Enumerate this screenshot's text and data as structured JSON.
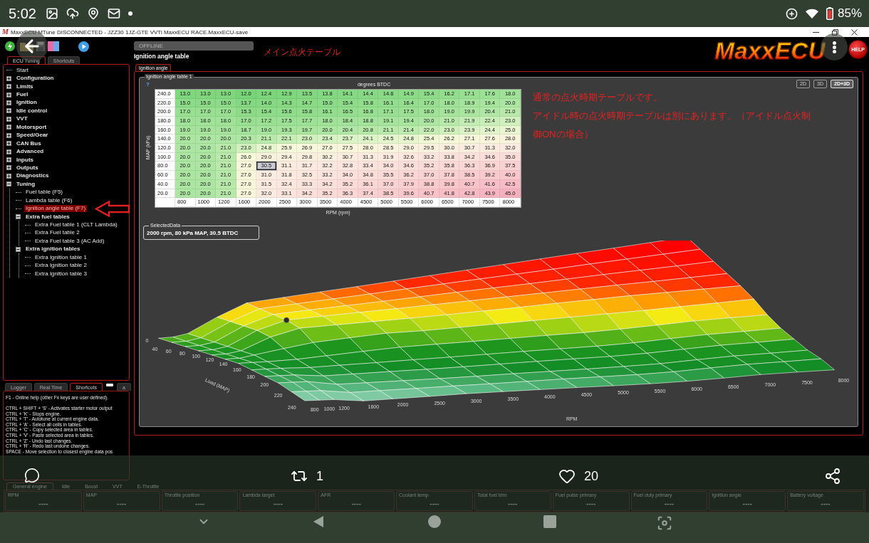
{
  "status_bar": {
    "time": "5:02",
    "battery": "85%"
  },
  "window": {
    "icon_letter": "M",
    "title": "MaxxECU MTune DISCONNECTED - JZZ30 1JZ-GTE VVTi MaxxECU RACE.MaxxECU-save"
  },
  "left_tabs": [
    {
      "label": "ECU Tuning",
      "selected": true
    },
    {
      "label": "Shortcuts",
      "selected": false
    }
  ],
  "tree": [
    {
      "label": "Start",
      "kind": "item",
      "selected": false
    },
    {
      "label": "Configuration",
      "kind": "group",
      "expanded": false,
      "selected": false
    },
    {
      "label": "Limits",
      "kind": "group",
      "expanded": false,
      "selected": false
    },
    {
      "label": "Fuel",
      "kind": "group",
      "expanded": false,
      "selected": false
    },
    {
      "label": "Ignition",
      "kind": "group",
      "expanded": false,
      "selected": false
    },
    {
      "label": "Idle control",
      "kind": "group",
      "expanded": false,
      "selected": false
    },
    {
      "label": "VVT",
      "kind": "group",
      "expanded": false,
      "selected": false
    },
    {
      "label": "Motorsport",
      "kind": "group",
      "expanded": false,
      "selected": false
    },
    {
      "label": "Speed/Gear",
      "kind": "group",
      "expanded": false,
      "selected": false
    },
    {
      "label": "CAN Bus",
      "kind": "group",
      "expanded": false,
      "selected": false
    },
    {
      "label": "Advanced",
      "kind": "group",
      "expanded": false,
      "selected": false
    },
    {
      "label": "Inputs",
      "kind": "group",
      "expanded": false,
      "selected": false
    },
    {
      "label": "Outputs",
      "kind": "group",
      "expanded": false,
      "selected": false
    },
    {
      "label": "Diagnostics",
      "kind": "group",
      "expanded": false,
      "selected": false
    },
    {
      "label": "Tuning",
      "kind": "group",
      "expanded": true,
      "selected": false,
      "children": [
        {
          "label": "Fuel table (F5)",
          "kind": "item",
          "selected": false
        },
        {
          "label": "Lambda table (F6)",
          "kind": "item",
          "selected": false
        },
        {
          "label": "Ignition angle table (F7)",
          "kind": "item",
          "selected": true
        },
        {
          "label": "Extra fuel tables",
          "kind": "group",
          "expanded": true,
          "selected": false,
          "children": [
            {
              "label": "Extra Fuel table 1 (CLT Lambda)",
              "kind": "item",
              "selected": false
            },
            {
              "label": "Extra Fuel table 2",
              "kind": "item",
              "selected": false
            },
            {
              "label": "Extra Fuel table 3 (AC Add)",
              "kind": "item",
              "selected": false
            }
          ]
        },
        {
          "label": "Extra ignition tables",
          "kind": "group",
          "expanded": true,
          "selected": false,
          "children": [
            {
              "label": "Extra Ignition table 1",
              "kind": "item",
              "selected": false
            },
            {
              "label": "Extra Ignition table 2",
              "kind": "item",
              "selected": false
            },
            {
              "label": "Extra Ignition table 3",
              "kind": "item",
              "selected": false
            }
          ]
        }
      ]
    }
  ],
  "help_tabs": [
    {
      "label": "Logger",
      "selected": false
    },
    {
      "label": "Real Time",
      "selected": false
    },
    {
      "label": "Shortcuts",
      "selected": true
    },
    {
      "label": "a",
      "selected": false
    }
  ],
  "help_text": {
    "intro": "F1 - Online help (other Fx keys are user defined).",
    "shortcuts": [
      "CTRL + SHIFT + 'S' - Activates starter motor output",
      "CTRL + 'K' - Stops engine.",
      "CTRL + 'T' - Autotune at current engine data.",
      "CTRL + 'A' - Select all cells in tables.",
      "CTRL + 'C' - Copy selected area in tables.",
      "CTRL + 'V' - Paste selected area in tables.",
      "CTRL + 'Z' - Undo last changes.",
      "CTRL + 'R' - Redo last undone changes.",
      "SPACE - Move selection to closest engine data pos"
    ]
  },
  "header": {
    "status": "OFFLINE",
    "title": "Ignition angle table",
    "annotation": "メイン点火テーブル",
    "logo": "MaxxECU",
    "help_button": "HELP"
  },
  "content_tabs": [
    {
      "label": "Ignition angle",
      "selected": true
    }
  ],
  "table": {
    "title": "Ignition angle table 1",
    "help_mark": "?",
    "unit_label": "degrees BTDC",
    "view_buttons": [
      {
        "label": "2D",
        "selected": false
      },
      {
        "label": "3D",
        "selected": false
      },
      {
        "label": "2D+3D",
        "selected": true
      }
    ],
    "y_label": "MAP (kPa)",
    "rows": [
      {
        "map": "240.0",
        "cells": [
          {
            "value": "13.0",
            "selected": false
          },
          {
            "value": "13.0",
            "selected": false
          },
          {
            "value": "13.0",
            "selected": false
          },
          {
            "value": "12.0",
            "selected": false
          },
          {
            "value": "12.4",
            "selected": false
          },
          {
            "value": "12.9",
            "selected": false
          },
          {
            "value": "13.5",
            "selected": false
          },
          {
            "value": "13.8",
            "selected": false
          },
          {
            "value": "14.1",
            "selected": false
          },
          {
            "value": "14.4",
            "selected": false
          },
          {
            "value": "14.6",
            "selected": false
          },
          {
            "value": "14.9",
            "selected": false
          },
          {
            "value": "15.4",
            "selected": false
          },
          {
            "value": "16.2",
            "selected": false
          },
          {
            "value": "17.1",
            "selected": false
          },
          {
            "value": "17.6",
            "selected": false
          },
          {
            "value": "18.0",
            "selected": false
          }
        ]
      },
      {
        "map": "220.0",
        "cells": [
          {
            "value": "15.0",
            "selected": false
          },
          {
            "value": "15.0",
            "selected": false
          },
          {
            "value": "15.0",
            "selected": false
          },
          {
            "value": "13.7",
            "selected": false
          },
          {
            "value": "14.0",
            "selected": false
          },
          {
            "value": "14.3",
            "selected": false
          },
          {
            "value": "14.7",
            "selected": false
          },
          {
            "value": "15.0",
            "selected": false
          },
          {
            "value": "15.4",
            "selected": false
          },
          {
            "value": "15.8",
            "selected": false
          },
          {
            "value": "16.1",
            "selected": false
          },
          {
            "value": "16.4",
            "selected": false
          },
          {
            "value": "17.0",
            "selected": false
          },
          {
            "value": "18.0",
            "selected": false
          },
          {
            "value": "18.9",
            "selected": false
          },
          {
            "value": "19.4",
            "selected": false
          },
          {
            "value": "20.0",
            "selected": false
          }
        ]
      },
      {
        "map": "200.0",
        "cells": [
          {
            "value": "17.0",
            "selected": false
          },
          {
            "value": "17.0",
            "selected": false
          },
          {
            "value": "17.0",
            "selected": false
          },
          {
            "value": "15.3",
            "selected": false
          },
          {
            "value": "15.4",
            "selected": false
          },
          {
            "value": "15.6",
            "selected": false
          },
          {
            "value": "15.8",
            "selected": false
          },
          {
            "value": "16.1",
            "selected": false
          },
          {
            "value": "16.5",
            "selected": false
          },
          {
            "value": "16.8",
            "selected": false
          },
          {
            "value": "17.1",
            "selected": false
          },
          {
            "value": "17.5",
            "selected": false
          },
          {
            "value": "18.0",
            "selected": false
          },
          {
            "value": "19.0",
            "selected": false
          },
          {
            "value": "19.9",
            "selected": false
          },
          {
            "value": "20.4",
            "selected": false
          },
          {
            "value": "21.0",
            "selected": false
          }
        ]
      },
      {
        "map": "180.0",
        "cells": [
          {
            "value": "18.0",
            "selected": false
          },
          {
            "value": "18.0",
            "selected": false
          },
          {
            "value": "18.0",
            "selected": false
          },
          {
            "value": "17.0",
            "selected": false
          },
          {
            "value": "17.2",
            "selected": false
          },
          {
            "value": "17.5",
            "selected": false
          },
          {
            "value": "17.7",
            "selected": false
          },
          {
            "value": "18.0",
            "selected": false
          },
          {
            "value": "18.4",
            "selected": false
          },
          {
            "value": "18.8",
            "selected": false
          },
          {
            "value": "19.1",
            "selected": false
          },
          {
            "value": "19.4",
            "selected": false
          },
          {
            "value": "20.0",
            "selected": false
          },
          {
            "value": "21.0",
            "selected": false
          },
          {
            "value": "21.9",
            "selected": false
          },
          {
            "value": "22.4",
            "selected": false
          },
          {
            "value": "23.0",
            "selected": false
          }
        ]
      },
      {
        "map": "160.0",
        "cells": [
          {
            "value": "19.0",
            "selected": false
          },
          {
            "value": "19.0",
            "selected": false
          },
          {
            "value": "19.0",
            "selected": false
          },
          {
            "value": "18.7",
            "selected": false
          },
          {
            "value": "19.0",
            "selected": false
          },
          {
            "value": "19.3",
            "selected": false
          },
          {
            "value": "19.7",
            "selected": false
          },
          {
            "value": "20.0",
            "selected": false
          },
          {
            "value": "20.4",
            "selected": false
          },
          {
            "value": "20.8",
            "selected": false
          },
          {
            "value": "21.1",
            "selected": false
          },
          {
            "value": "21.4",
            "selected": false
          },
          {
            "value": "22.0",
            "selected": false
          },
          {
            "value": "23.0",
            "selected": false
          },
          {
            "value": "23.9",
            "selected": false
          },
          {
            "value": "24.4",
            "selected": false
          },
          {
            "value": "25.0",
            "selected": false
          }
        ]
      },
      {
        "map": "140.0",
        "cells": [
          {
            "value": "20.0",
            "selected": false
          },
          {
            "value": "20.0",
            "selected": false
          },
          {
            "value": "20.0",
            "selected": false
          },
          {
            "value": "20.3",
            "selected": false
          },
          {
            "value": "21.1",
            "selected": false
          },
          {
            "value": "22.1",
            "selected": false
          },
          {
            "value": "23.0",
            "selected": false
          },
          {
            "value": "23.4",
            "selected": false
          },
          {
            "value": "23.7",
            "selected": false
          },
          {
            "value": "24.1",
            "selected": false
          },
          {
            "value": "24.5",
            "selected": false
          },
          {
            "value": "24.8",
            "selected": false
          },
          {
            "value": "25.4",
            "selected": false
          },
          {
            "value": "26.2",
            "selected": false
          },
          {
            "value": "27.1",
            "selected": false
          },
          {
            "value": "27.6",
            "selected": false
          },
          {
            "value": "28.0",
            "selected": false
          }
        ]
      },
      {
        "map": "120.0",
        "cells": [
          {
            "value": "20.0",
            "selected": false
          },
          {
            "value": "20.0",
            "selected": false
          },
          {
            "value": "21.0",
            "selected": false
          },
          {
            "value": "23.0",
            "selected": false
          },
          {
            "value": "24.8",
            "selected": false
          },
          {
            "value": "25.9",
            "selected": false
          },
          {
            "value": "26.9",
            "selected": false
          },
          {
            "value": "27.0",
            "selected": false
          },
          {
            "value": "27.5",
            "selected": false
          },
          {
            "value": "28.0",
            "selected": false
          },
          {
            "value": "28.5",
            "selected": false
          },
          {
            "value": "29.0",
            "selected": false
          },
          {
            "value": "29.5",
            "selected": false
          },
          {
            "value": "30.0",
            "selected": false
          },
          {
            "value": "30.7",
            "selected": false
          },
          {
            "value": "31.3",
            "selected": false
          },
          {
            "value": "32.0",
            "selected": false
          }
        ]
      },
      {
        "map": "100.0",
        "cells": [
          {
            "value": "20.0",
            "selected": false
          },
          {
            "value": "20.0",
            "selected": false
          },
          {
            "value": "21.0",
            "selected": false
          },
          {
            "value": "26.0",
            "selected": false
          },
          {
            "value": "29.0",
            "selected": false
          },
          {
            "value": "29.4",
            "selected": false
          },
          {
            "value": "29.8",
            "selected": false
          },
          {
            "value": "30.2",
            "selected": false
          },
          {
            "value": "30.7",
            "selected": false
          },
          {
            "value": "31.3",
            "selected": false
          },
          {
            "value": "31.9",
            "selected": false
          },
          {
            "value": "32.6",
            "selected": false
          },
          {
            "value": "33.2",
            "selected": false
          },
          {
            "value": "33.8",
            "selected": false
          },
          {
            "value": "34.2",
            "selected": false
          },
          {
            "value": "34.6",
            "selected": false
          },
          {
            "value": "35.0",
            "selected": false
          }
        ]
      },
      {
        "map": "80.0",
        "cells": [
          {
            "value": "20.0",
            "selected": false
          },
          {
            "value": "20.0",
            "selected": false
          },
          {
            "value": "21.0",
            "selected": false
          },
          {
            "value": "27.0",
            "selected": false
          },
          {
            "value": "30.5",
            "selected": true
          },
          {
            "value": "31.1",
            "selected": false
          },
          {
            "value": "31.7",
            "selected": false
          },
          {
            "value": "32.2",
            "selected": false
          },
          {
            "value": "32.8",
            "selected": false
          },
          {
            "value": "33.4",
            "selected": false
          },
          {
            "value": "34.0",
            "selected": false
          },
          {
            "value": "34.6",
            "selected": false
          },
          {
            "value": "35.2",
            "selected": false
          },
          {
            "value": "35.8",
            "selected": false
          },
          {
            "value": "36.3",
            "selected": false
          },
          {
            "value": "36.9",
            "selected": false
          },
          {
            "value": "37.5",
            "selected": false
          }
        ]
      },
      {
        "map": "60.0",
        "cells": [
          {
            "value": "20.0",
            "selected": false
          },
          {
            "value": "20.0",
            "selected": false
          },
          {
            "value": "21.0",
            "selected": false
          },
          {
            "value": "27.0",
            "selected": false
          },
          {
            "value": "31.0",
            "selected": false
          },
          {
            "value": "31.8",
            "selected": false
          },
          {
            "value": "32.5",
            "selected": false
          },
          {
            "value": "33.2",
            "selected": false
          },
          {
            "value": "34.0",
            "selected": false
          },
          {
            "value": "34.8",
            "selected": false
          },
          {
            "value": "35.5",
            "selected": false
          },
          {
            "value": "36.2",
            "selected": false
          },
          {
            "value": "37.0",
            "selected": false
          },
          {
            "value": "37.8",
            "selected": false
          },
          {
            "value": "38.5",
            "selected": false
          },
          {
            "value": "39.2",
            "selected": false
          },
          {
            "value": "40.0",
            "selected": false
          }
        ]
      },
      {
        "map": "40.0",
        "cells": [
          {
            "value": "20.0",
            "selected": false
          },
          {
            "value": "20.0",
            "selected": false
          },
          {
            "value": "21.0",
            "selected": false
          },
          {
            "value": "27.0",
            "selected": false
          },
          {
            "value": "31.5",
            "selected": false
          },
          {
            "value": "32.4",
            "selected": false
          },
          {
            "value": "33.3",
            "selected": false
          },
          {
            "value": "34.2",
            "selected": false
          },
          {
            "value": "35.2",
            "selected": false
          },
          {
            "value": "36.1",
            "selected": false
          },
          {
            "value": "37.0",
            "selected": false
          },
          {
            "value": "37.9",
            "selected": false
          },
          {
            "value": "38.8",
            "selected": false
          },
          {
            "value": "39.8",
            "selected": false
          },
          {
            "value": "40.7",
            "selected": false
          },
          {
            "value": "41.6",
            "selected": false
          },
          {
            "value": "42.5",
            "selected": false
          }
        ]
      },
      {
        "map": "20.0",
        "cells": [
          {
            "value": "20.0",
            "selected": false
          },
          {
            "value": "20.0",
            "selected": false
          },
          {
            "value": "21.0",
            "selected": false
          },
          {
            "value": "27.0",
            "selected": false
          },
          {
            "value": "32.0",
            "selected": false
          },
          {
            "value": "33.1",
            "selected": false
          },
          {
            "value": "34.2",
            "selected": false
          },
          {
            "value": "35.2",
            "selected": false
          },
          {
            "value": "36.3",
            "selected": false
          },
          {
            "value": "37.4",
            "selected": false
          },
          {
            "value": "38.5",
            "selected": false
          },
          {
            "value": "39.6",
            "selected": false
          },
          {
            "value": "40.7",
            "selected": false
          },
          {
            "value": "41.8",
            "selected": false
          },
          {
            "value": "42.8",
            "selected": false
          },
          {
            "value": "43.9",
            "selected": false
          },
          {
            "value": "45.0",
            "selected": false
          }
        ]
      }
    ],
    "rpm_axis_values": [
      "800",
      "1000",
      "1200",
      "1600",
      "2000",
      "2500",
      "3000",
      "3500",
      "4000",
      "4500",
      "5000",
      "5500",
      "6000",
      "6500",
      "7000",
      "7500",
      "8000"
    ],
    "x_label": "RPM (rpm)"
  },
  "notes": [
    "通常の点火時期テーブルです。",
    "アイドル時の点火時期テーブルは別にあります。（アイドル点火制御ONの場合）"
  ],
  "selected_data": {
    "title": "SelectedData",
    "text": "2000 rpm, 80 kPa MAP, 30.5 BTDC"
  },
  "surface_3d": {
    "z_tick": "0",
    "load_ticks": [
      "40",
      "60",
      "80",
      "100",
      "120",
      "140",
      "160",
      "180",
      "200",
      "220",
      "240"
    ],
    "rpm_ticks": [
      "800",
      "1000",
      "1200",
      "1600",
      "2000",
      "2500",
      "3000",
      "3500",
      "4000",
      "4500",
      "5000",
      "5500",
      "6000",
      "6500",
      "7000",
      "7500",
      "8000"
    ],
    "load_title": "Load (MAP)",
    "rpm_title": "RPM"
  },
  "gauge_tabs": [
    {
      "label": "General engine",
      "selected": true
    },
    {
      "label": "Idle",
      "selected": false
    },
    {
      "label": "Boost",
      "selected": false
    },
    {
      "label": "VVT",
      "selected": false
    },
    {
      "label": "E-Throttle",
      "selected": false
    }
  ],
  "gauges": [
    {
      "label": "RPM",
      "value": "----"
    },
    {
      "label": "MAP",
      "value": "----"
    },
    {
      "label": "Throttle position",
      "value": "----"
    },
    {
      "label": "Lambda target",
      "value": "----"
    },
    {
      "label": "AFR",
      "value": "----"
    },
    {
      "label": "Coolant temp",
      "value": "----"
    },
    {
      "label": "Total fuel trim",
      "value": "----"
    },
    {
      "label": "Fuel pulse primary",
      "value": "----"
    },
    {
      "label": "Fuel duty primary",
      "value": "----"
    },
    {
      "label": "Ignition angle",
      "value": "----"
    },
    {
      "label": "Battery voltage",
      "value": "----"
    }
  ],
  "post_actions": {
    "retweets": "1",
    "likes": "20"
  }
}
